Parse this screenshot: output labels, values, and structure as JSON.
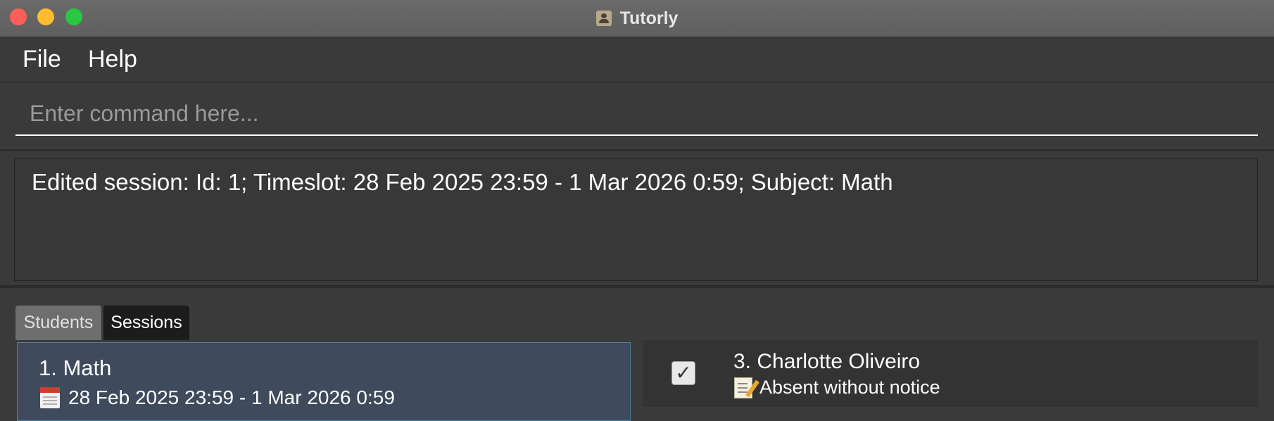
{
  "window": {
    "title": "Tutorly",
    "icon": "tutorly-app-icon"
  },
  "menu": {
    "file": "File",
    "help": "Help"
  },
  "command": {
    "placeholder": "Enter command here...",
    "value": ""
  },
  "result": {
    "text": "Edited session: Id: 1; Timeslot: 28 Feb 2025 23:59 - 1 Mar 2026 0:59; Subject: Math"
  },
  "tabs": {
    "students": "Students",
    "sessions": "Sessions",
    "selected": "Sessions"
  },
  "sessions": [
    {
      "title": "1. Math",
      "timeslot": "28 Feb 2025 23:59 - 1 Mar 2026 0:59",
      "icon": "calendar-icon",
      "selected": true
    }
  ],
  "attendance": [
    {
      "name": "3. Charlotte Oliveiro",
      "status": "Absent without notice",
      "checked": true,
      "icon": "memo-icon"
    }
  ],
  "colors": {
    "close": "#fe5f57",
    "minimize": "#febc2e",
    "maximize": "#28c840",
    "background": "#3a3a3a",
    "selected_card": "#3f4a5c"
  }
}
